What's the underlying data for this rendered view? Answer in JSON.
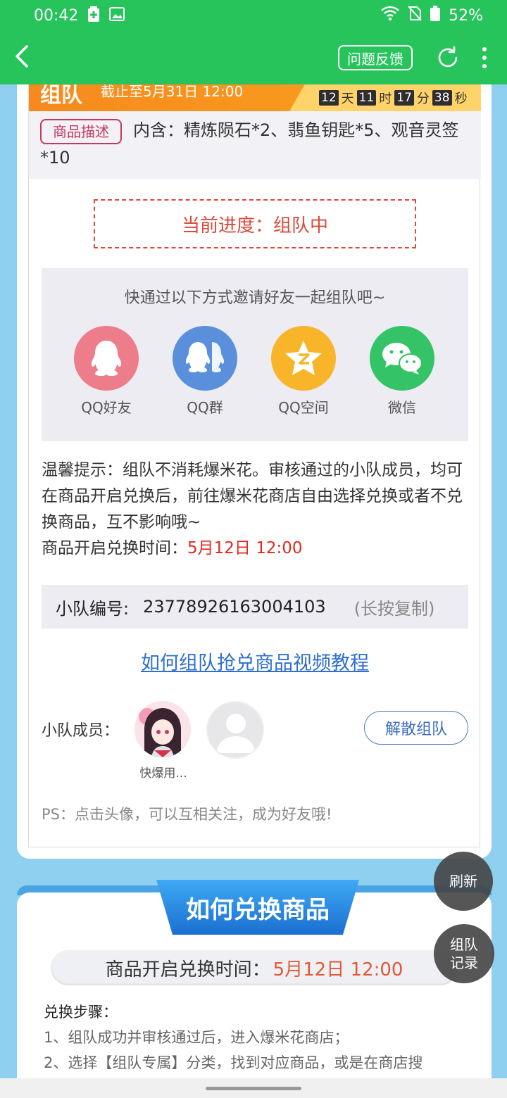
{
  "status_bar": {
    "time": "00:42",
    "battery": "52%"
  },
  "header": {
    "feedback_label": "问题反馈"
  },
  "banner": {
    "title": "组队",
    "deadline": "截止至5月31日 12:00",
    "countdown": {
      "days": "12",
      "days_unit": "天",
      "hours": "11",
      "hours_unit": "时",
      "minutes": "17",
      "minutes_unit": "分",
      "seconds": "38",
      "seconds_unit": "秒"
    }
  },
  "product": {
    "tag": "商品描述",
    "description": "内含：精炼陨石*2、翡鱼钥匙*5、观音灵签*10"
  },
  "progress": {
    "text": "当前进度：组队中"
  },
  "invite": {
    "title": "快通过以下方式邀请好友一起组队吧~",
    "options": [
      {
        "label": "QQ好友",
        "icon": "qq-icon",
        "color": "#ee7d8c"
      },
      {
        "label": "QQ群",
        "icon": "qq-group-icon",
        "color": "#5a8fdc"
      },
      {
        "label": "QQ空间",
        "icon": "qzone-icon",
        "color": "#f9b52a"
      },
      {
        "label": "微信",
        "icon": "wechat-icon",
        "color": "#35c368"
      }
    ]
  },
  "tips": {
    "text": "温馨提示：组队不消耗爆米花。审核通过的小队成员，均可在商品开启兑换后，前往爆米花商店自由选择兑换或者不兑换商品，互不影响哦~",
    "open_time_label": "商品开启兑换时间：",
    "open_time_value": "5月12日 12:00"
  },
  "team": {
    "id_label": "小队编号:",
    "id_value": "23778926163004103",
    "copy_hint": "(长按复制)",
    "video_link": "如何组队抢兑商品视频教程",
    "members_label": "小队成员：",
    "member1_name": "快爆用...",
    "disband_label": "解散组队",
    "ps": "PS：点击头像，可以互相关注，成为好友哦!"
  },
  "how_to": {
    "ribbon": "如何兑换商品",
    "open_time_label": "商品开启兑换时间：",
    "open_time_value": "5月12日 12:00",
    "steps_title": "兑换步骤：",
    "step1": "1、组队成功并审核通过后，进入爆米花商店；",
    "step2": "2、选择【组队专属】分类，找到对应商品，或是在商店搜"
  },
  "fabs": {
    "refresh": "刷新",
    "records": "组队记录"
  }
}
